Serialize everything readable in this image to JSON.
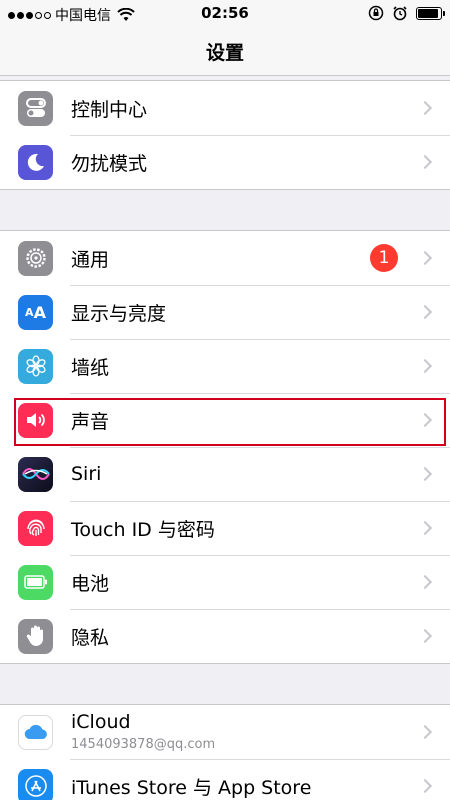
{
  "status_bar": {
    "carrier": "中国电信",
    "time": "02:56",
    "signal_dots": [
      true,
      true,
      true,
      false,
      false
    ],
    "battery_level": 0.9
  },
  "nav": {
    "title": "设置"
  },
  "groups": [
    {
      "items": [
        {
          "label": "控制中心",
          "icon": "control-center-icon",
          "color": "#8e8e93"
        },
        {
          "label": "勿扰模式",
          "icon": "do-not-disturb-icon",
          "color": "#5856d6"
        }
      ]
    },
    {
      "items": [
        {
          "label": "通用",
          "icon": "gear-icon",
          "color": "#8e8e93",
          "badge": "1"
        },
        {
          "label": "显示与亮度",
          "icon": "display-brightness-icon",
          "color": "#1e7ae5"
        },
        {
          "label": "墙纸",
          "icon": "wallpaper-icon",
          "color": "#35aadc"
        },
        {
          "label": "声音",
          "icon": "sound-icon",
          "color": "#ff2d55"
        },
        {
          "label": "Siri",
          "icon": "siri-icon",
          "color": "#1a1a2e"
        },
        {
          "label": "Touch ID 与密码",
          "icon": "fingerprint-icon",
          "color": "#ff2d55"
        },
        {
          "label": "电池",
          "icon": "battery-icon",
          "color": "#4cd964"
        },
        {
          "label": "隐私",
          "icon": "privacy-hand-icon",
          "color": "#8e8e93"
        }
      ]
    },
    {
      "items": [
        {
          "label": "iCloud",
          "sublabel": "1454093878@qq.com",
          "icon": "icloud-icon",
          "color": "#ffffff"
        },
        {
          "label": "iTunes Store 与 App Store",
          "icon": "app-store-icon",
          "color": "#1a8cf0"
        }
      ]
    }
  ]
}
